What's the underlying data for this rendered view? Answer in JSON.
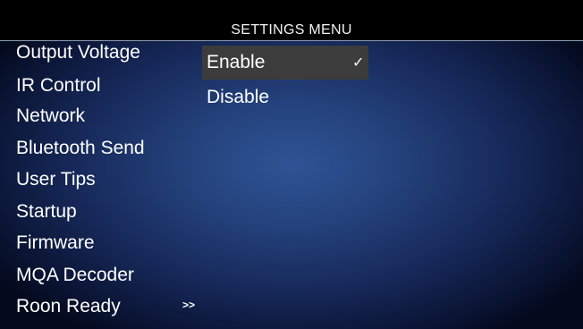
{
  "header": {
    "title": "SETTINGS MENU"
  },
  "menu": {
    "items": [
      {
        "label": "Output Voltage"
      },
      {
        "label": "IR Control"
      },
      {
        "label": "Network"
      },
      {
        "label": "Bluetooth Send"
      },
      {
        "label": "User Tips"
      },
      {
        "label": "Startup"
      },
      {
        "label": "Firmware"
      },
      {
        "label": "MQA Decoder"
      },
      {
        "label": "Roon Ready"
      }
    ],
    "more_indicator": ">>"
  },
  "submenu": {
    "options": [
      {
        "label": "Enable",
        "selected": true,
        "check": "✓"
      },
      {
        "label": "Disable",
        "selected": false
      }
    ]
  },
  "colors": {
    "background_center": "#2f5395",
    "background_edge": "#040a1e",
    "title_bar": "#000000",
    "selection_highlight": "#3c3c3c",
    "text": "#ffffff"
  }
}
